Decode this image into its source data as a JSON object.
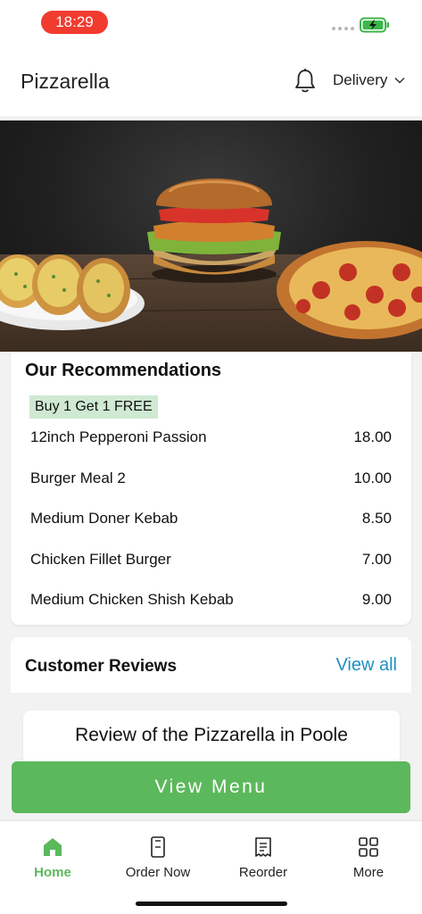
{
  "status_bar": {
    "time": "18:29",
    "battery_icon": "battery-charging-icon"
  },
  "header": {
    "title": "Pizzarella",
    "bell_icon": "bell-icon",
    "delivery_label": "Delivery",
    "chevron_icon": "chevron-down-icon"
  },
  "hero": {
    "image": "food-banner-burger-pizza-garlic-bread"
  },
  "recommendations": {
    "title": "Our Recommendations",
    "promo": "Buy 1 Get 1 FREE",
    "items": [
      {
        "name": "12inch Pepperoni Passion",
        "price": "18.00"
      },
      {
        "name": "Burger Meal 2",
        "price": "10.00"
      },
      {
        "name": "Medium Doner Kebab",
        "price": "8.50"
      },
      {
        "name": "Chicken Fillet Burger",
        "price": "7.00"
      },
      {
        "name": "Medium Chicken Shish Kebab",
        "price": "9.00"
      }
    ]
  },
  "reviews": {
    "title": "Customer Reviews",
    "view_all": "View all",
    "review_heading": "Review of the Pizzarella in Poole"
  },
  "cta": {
    "label": "View Menu"
  },
  "tabs": [
    {
      "label": "Home",
      "icon": "home-icon",
      "active": true
    },
    {
      "label": "Order Now",
      "icon": "order-icon",
      "active": false
    },
    {
      "label": "Reorder",
      "icon": "receipt-icon",
      "active": false
    },
    {
      "label": "More",
      "icon": "grid-icon",
      "active": false
    }
  ],
  "colors": {
    "accent_green": "#5cb85c",
    "link_blue": "#1f8fc4",
    "time_pill_red": "#f23b2f",
    "promo_bg": "#cfe9d2"
  }
}
